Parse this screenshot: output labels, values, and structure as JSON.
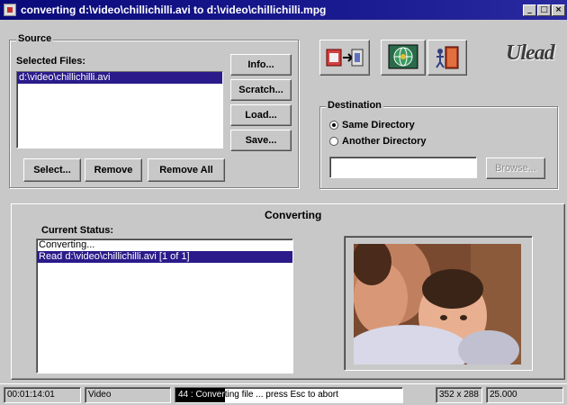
{
  "window": {
    "title": "converting d:\\video\\chillichilli.avi to d:\\video\\chillichilli.mpg",
    "controls": [
      "_",
      "□",
      "×"
    ]
  },
  "source": {
    "group_label": "Source",
    "files_label": "Selected Files:",
    "files": [
      "d:\\video\\chillichilli.avi"
    ],
    "buttons": {
      "info": "Info...",
      "scratch": "Scratch...",
      "load": "Load...",
      "save": "Save...",
      "select": "Select...",
      "remove": "Remove",
      "remove_all": "Remove All"
    }
  },
  "toolbar": {
    "icons": [
      "convert-icon",
      "globe-icon",
      "exit-door-icon"
    ]
  },
  "logo": {
    "text": "Ulead"
  },
  "destination": {
    "group_label": "Destination",
    "options": [
      "Same Directory",
      "Another Directory"
    ],
    "selected_option": "Same Directory",
    "path_value": "",
    "browse_label": "Browse..."
  },
  "converting": {
    "panel_title": "Converting",
    "status_label": "Current Status:",
    "status_lines": [
      "Converting...",
      "Read d:\\video\\chillichilli.avi [1 of 1]"
    ]
  },
  "statusbar": {
    "timecode": "00:01:14:01",
    "mode": "Video",
    "progress_percent": 44,
    "progress_text": "44 : Converting file ... press Esc to abort",
    "frame_size": "352 x 288",
    "frame_rate": "25.000"
  }
}
